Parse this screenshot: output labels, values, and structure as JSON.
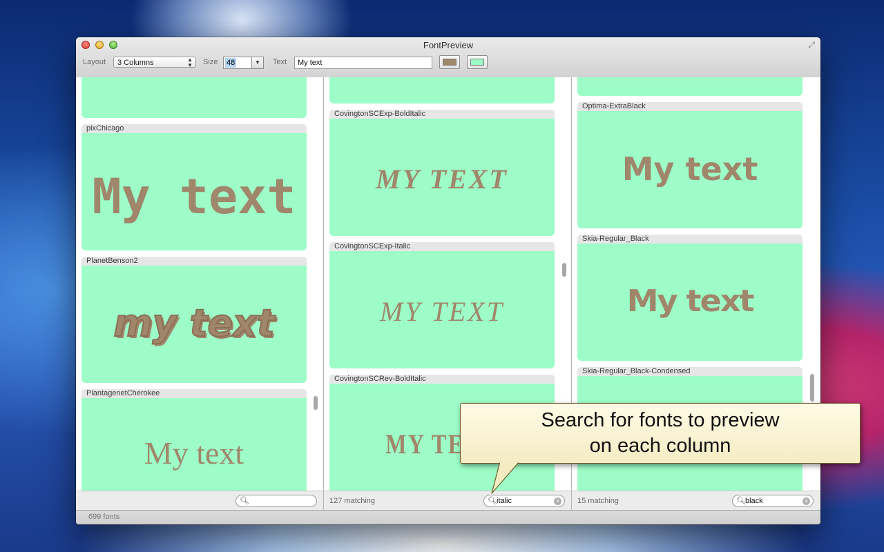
{
  "window": {
    "title": "FontPreview"
  },
  "toolbar": {
    "layout_label": "Layout",
    "layout_value": "3 Columns",
    "size_label": "Size",
    "size_value": "48",
    "text_label": "Text",
    "text_value": "My text",
    "text_color": "#a0866b",
    "background_color": "#9dfcc7"
  },
  "columns": [
    {
      "fonts": [
        {
          "name": "",
          "sample": ""
        },
        {
          "name": "pixChicago",
          "sample": "My text"
        },
        {
          "name": "PlanetBenson2",
          "sample": "my text"
        },
        {
          "name": "PlantagenetCherokee",
          "sample": "My text"
        }
      ],
      "matching": "",
      "search": ""
    },
    {
      "fonts": [
        {
          "name": "",
          "sample": ""
        },
        {
          "name": "CovingtonSCExp-BoldItalic",
          "sample": "MY TEXT"
        },
        {
          "name": "CovingtonSCExp-Italic",
          "sample": "MY TEXT"
        },
        {
          "name": "CovingtonSCRev-BoldItalic",
          "sample": "MY TEXT"
        }
      ],
      "matching": "127 matching",
      "search": "italic"
    },
    {
      "fonts": [
        {
          "name": "",
          "sample": ""
        },
        {
          "name": "Optima-ExtraBlack",
          "sample": "My text"
        },
        {
          "name": "Skia-Regular_Black",
          "sample": "My text"
        },
        {
          "name": "Skia-Regular_Black-Condensed",
          "sample": ""
        }
      ],
      "matching": "15 matching",
      "search": "black"
    }
  ],
  "status": {
    "font_count": "699 fonts"
  },
  "callout": {
    "line1": "Search for fonts to preview",
    "line2": "on each column"
  }
}
